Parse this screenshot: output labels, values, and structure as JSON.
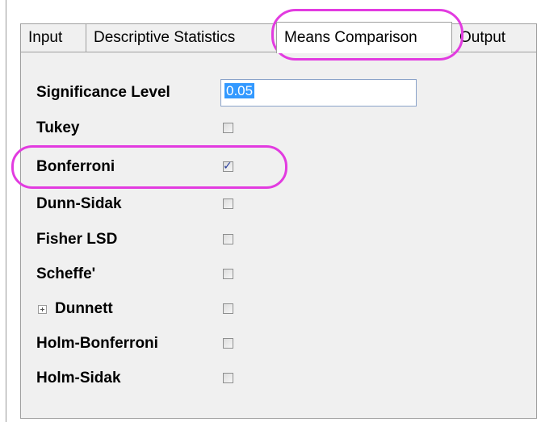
{
  "tabs": [
    {
      "label": "Input",
      "active": false
    },
    {
      "label": "Descriptive Statistics",
      "active": false
    },
    {
      "label": "Means Comparison",
      "active": true
    },
    {
      "label": "Output",
      "active": false
    }
  ],
  "significance": {
    "label": "Significance Level",
    "value": "0.05"
  },
  "options": [
    {
      "label": "Tukey",
      "checked": false
    },
    {
      "label": "Bonferroni",
      "checked": true
    },
    {
      "label": "Dunn-Sidak",
      "checked": false
    },
    {
      "label": "Fisher LSD",
      "checked": false
    },
    {
      "label": "Scheffe'",
      "checked": false
    },
    {
      "label": "Dunnett",
      "checked": false,
      "expandable": true
    },
    {
      "label": "Holm-Bonferroni",
      "checked": false
    },
    {
      "label": "Holm-Sidak",
      "checked": false
    }
  ],
  "colors": {
    "highlight": "#e23be0",
    "selection": "#3399ff",
    "checkmark": "#2a3f9a"
  },
  "icons": {
    "checkmark": "check-icon",
    "expander": "plus-box-icon"
  }
}
